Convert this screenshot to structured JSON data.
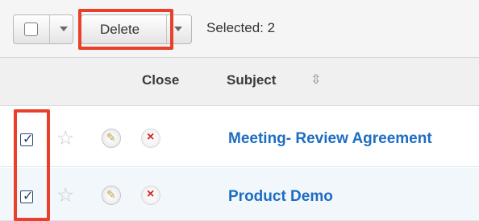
{
  "toolbar": {
    "delete_label": "Delete",
    "selected_text": "Selected: 2"
  },
  "table": {
    "columns": [
      "Close",
      "Subject"
    ],
    "rows": [
      {
        "subject": "Meeting- Review Agreement",
        "checked": true
      },
      {
        "subject": "Product Demo",
        "checked": true
      }
    ]
  },
  "icons": {
    "sort": "sort-icon",
    "star": "star-icon",
    "edit": "pencil-icon",
    "close": "close-icon"
  },
  "colors": {
    "highlight": "#e8402a",
    "link": "#1d6dc2",
    "close_x": "#d42222"
  }
}
